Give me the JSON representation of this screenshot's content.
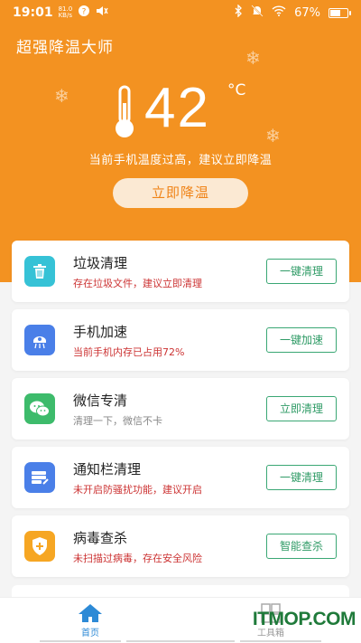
{
  "status_bar": {
    "time": "19:01",
    "net_speed_value": "81.0",
    "net_speed_unit": "KB/s",
    "battery": "67%",
    "battery_level": 0.67
  },
  "app": {
    "title": "超强降温大师"
  },
  "hero": {
    "temperature": "42",
    "unit": "°C",
    "warning": "当前手机温度过高，建议立即降温",
    "cool_button": "立即降温",
    "bg_color": "#f39221"
  },
  "cards": [
    {
      "name": "垃圾清理",
      "desc": "存在垃圾文件，建议立即清理",
      "action": "一键清理",
      "icon": "trash-icon",
      "color": "#36c2d6"
    },
    {
      "name": "手机加速",
      "desc": "当前手机内存已占用72%",
      "action": "一键加速",
      "icon": "rocket-icon",
      "color": "#4a7fe8"
    },
    {
      "name": "微信专清",
      "desc": "清理一下，微信不卡",
      "action": "立即清理",
      "icon": "wechat-icon",
      "color": "#3dbb6b"
    },
    {
      "name": "通知栏清理",
      "desc": "未开启防骚扰功能，建议开启",
      "action": "一键清理",
      "icon": "notification-icon",
      "color": "#4a7fe8"
    },
    {
      "name": "病毒查杀",
      "desc": "未扫描过病毒，存在安全风险",
      "action": "智能查杀",
      "icon": "shield-icon",
      "color": "#f6a623"
    }
  ],
  "tabs": [
    {
      "label": "首页",
      "icon": "home-icon",
      "active": true
    },
    {
      "label": "工具箱",
      "icon": "toolbox-icon",
      "active": false
    }
  ],
  "watermark": "ITMOP.COM",
  "colors": {
    "accent": "#f39221",
    "button_green": "#2f9b66",
    "alert_red": "#cc3333",
    "tab_active": "#2d8ad6"
  }
}
